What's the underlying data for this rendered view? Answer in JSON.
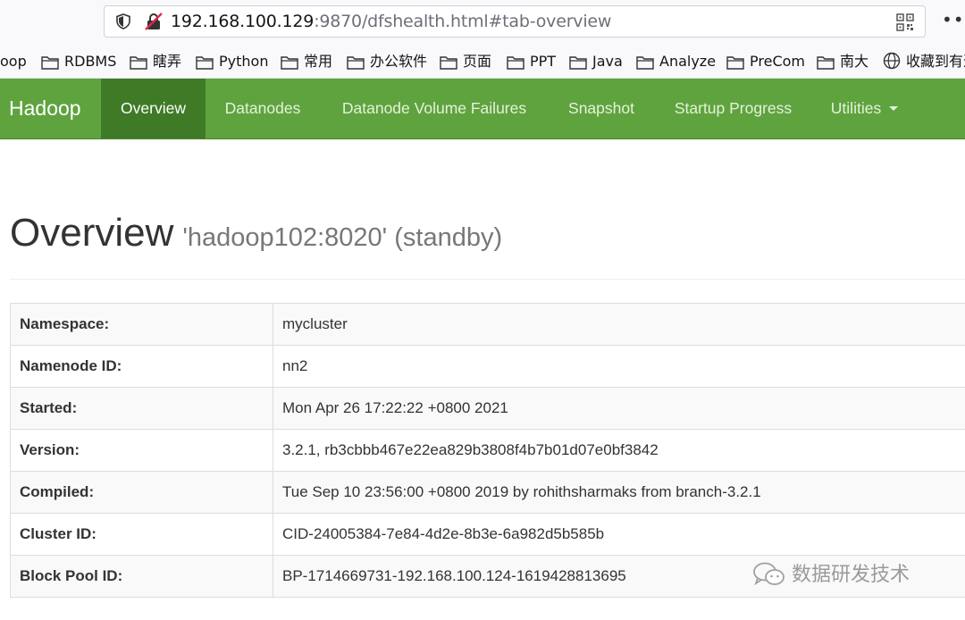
{
  "browser": {
    "url_host": "192.168.100.129",
    "url_rest": ":9870/dfshealth.html#tab-overview",
    "bookmarks": [
      {
        "label": "oop",
        "icon": "none"
      },
      {
        "label": "RDBMS",
        "icon": "folder-icon"
      },
      {
        "label": "瞎弄",
        "icon": "folder-icon"
      },
      {
        "label": "Python",
        "icon": "folder-icon"
      },
      {
        "label": "常用",
        "icon": "folder-icon"
      },
      {
        "label": "办公软件",
        "icon": "folder-icon"
      },
      {
        "label": "页面",
        "icon": "folder-icon"
      },
      {
        "label": "PPT",
        "icon": "folder-icon"
      },
      {
        "label": "Java",
        "icon": "folder-icon"
      },
      {
        "label": "Analyze",
        "icon": "folder-icon"
      },
      {
        "label": "PreCom",
        "icon": "folder-icon"
      },
      {
        "label": "南大",
        "icon": "folder-icon"
      },
      {
        "label": "收藏到有道",
        "icon": "globe-icon"
      }
    ]
  },
  "navbar": {
    "brand": "Hadoop",
    "items": [
      {
        "label": "Overview",
        "active": true
      },
      {
        "label": "Datanodes"
      },
      {
        "label": "Datanode Volume Failures"
      },
      {
        "label": "Snapshot"
      },
      {
        "label": "Startup Progress"
      },
      {
        "label": "Utilities",
        "dropdown": true
      }
    ],
    "color": "#5fa33e",
    "active_color": "#3f7a26"
  },
  "header": {
    "title": "Overview",
    "subtitle": "'hadoop102:8020' (standby)"
  },
  "overview": {
    "rows": [
      {
        "key": "Namespace:",
        "value": "mycluster"
      },
      {
        "key": "Namenode ID:",
        "value": "nn2"
      },
      {
        "key": "Started:",
        "value": "Mon Apr 26 17:22:22 +0800 2021"
      },
      {
        "key": "Version:",
        "value": "3.2.1, rb3cbbb467e22ea829b3808f4b7b01d07e0bf3842"
      },
      {
        "key": "Compiled:",
        "value": "Tue Sep 10 23:56:00 +0800 2019 by rohithsharmaks from branch-3.2.1"
      },
      {
        "key": "Cluster ID:",
        "value": "CID-24005384-7e84-4d2e-8b3e-6a982d5b585b"
      },
      {
        "key": "Block Pool ID:",
        "value": "BP-1714669731-192.168.100.124-1619428813695"
      }
    ]
  },
  "watermark": {
    "text": "数据研发技术",
    "icon": "wechat-icon"
  }
}
